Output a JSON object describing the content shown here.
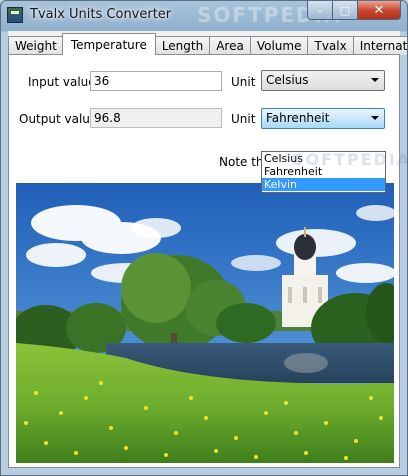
{
  "window": {
    "title": "Tvalx Units Converter",
    "icon": "app-icon",
    "controls": {
      "minimize_glyph": "–",
      "maximize_glyph": "□",
      "close_glyph": "✕"
    }
  },
  "tabs": [
    {
      "label": "Weight"
    },
    {
      "label": "Temperature",
      "active": true
    },
    {
      "label": "Length"
    },
    {
      "label": "Area"
    },
    {
      "label": "Volume"
    },
    {
      "label": "Tvalx"
    },
    {
      "label": "International"
    }
  ],
  "form": {
    "input_label": "Input value",
    "input_value": "36",
    "input_unit_label": "Unit",
    "input_unit": "Celsius",
    "output_label": "Output value",
    "output_value": "96.8",
    "output_unit_label": "Unit",
    "output_unit": "Fahrenheit",
    "note": "Note tha"
  },
  "dropdown": {
    "options": [
      "Celsius",
      "Fahrenheit",
      "Kelvin"
    ],
    "highlighted": "Kelvin"
  },
  "watermark": {
    "title_text": "SOFTPEDIA",
    "dropdown_text": "SOFTPEDIA"
  },
  "colors": {
    "highlight": "#3399ff",
    "close_button": "#c7452d",
    "sky": "#2f6fc4",
    "grass": "#6fae2e",
    "flowers": "#f2e12a"
  }
}
